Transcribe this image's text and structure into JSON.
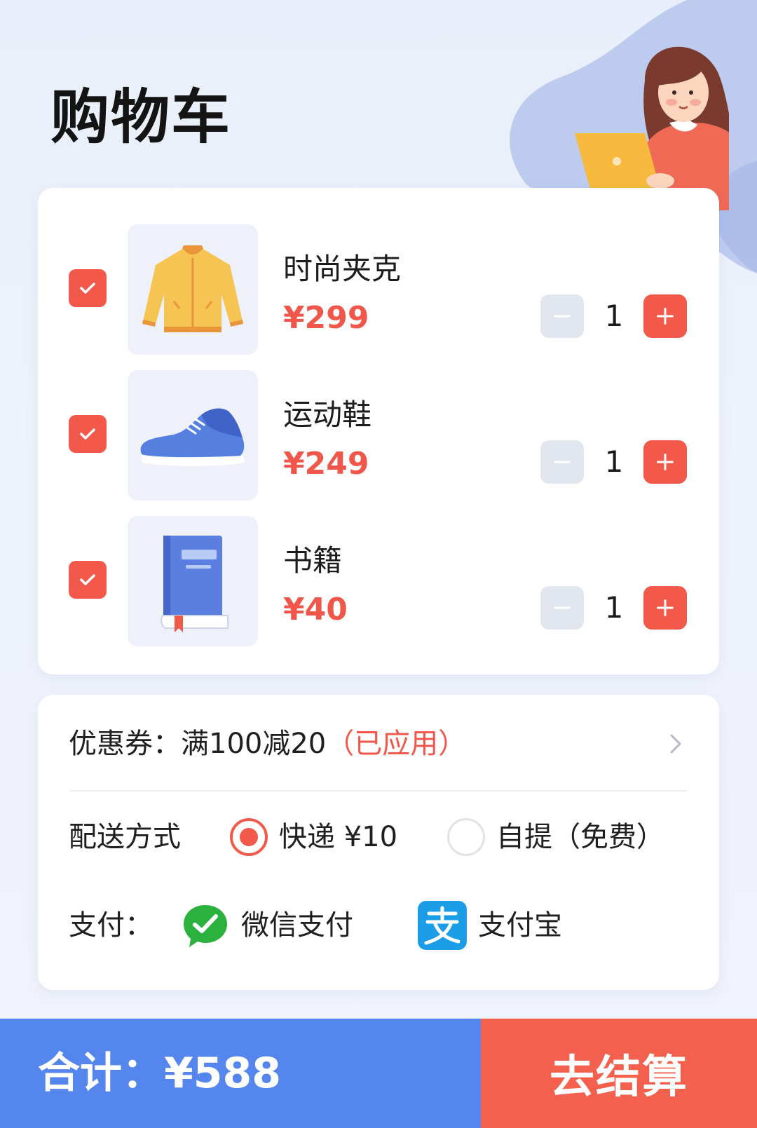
{
  "header": {
    "title": "购物车"
  },
  "cart": {
    "items": [
      {
        "name": "时尚夹克",
        "price": "¥299",
        "quantity": "1",
        "checked": true,
        "image": "jacket-image"
      },
      {
        "name": "运动鞋",
        "price": "¥249",
        "quantity": "1",
        "checked": true,
        "image": "sneaker-image"
      },
      {
        "name": "书籍",
        "price": "¥40",
        "quantity": "1",
        "checked": true,
        "image": "book-image"
      }
    ]
  },
  "coupon": {
    "label": "优惠券：",
    "value": "满100减20",
    "status": "（已应用）"
  },
  "delivery": {
    "label": "配送方式",
    "options": [
      {
        "label": "快递 ¥10",
        "selected": true
      },
      {
        "label": "自提（免费）",
        "selected": false
      }
    ]
  },
  "payment": {
    "label": "支付：",
    "methods": [
      {
        "label": "微信支付",
        "icon": "wechat-pay-icon"
      },
      {
        "label": "支付宝",
        "icon": "alipay-icon"
      }
    ]
  },
  "footer": {
    "total": "合计：¥588",
    "checkout_label": "去结算"
  },
  "colors": {
    "accent": "#f3594b",
    "primary": "#5586ee",
    "price": "#f0574a"
  }
}
